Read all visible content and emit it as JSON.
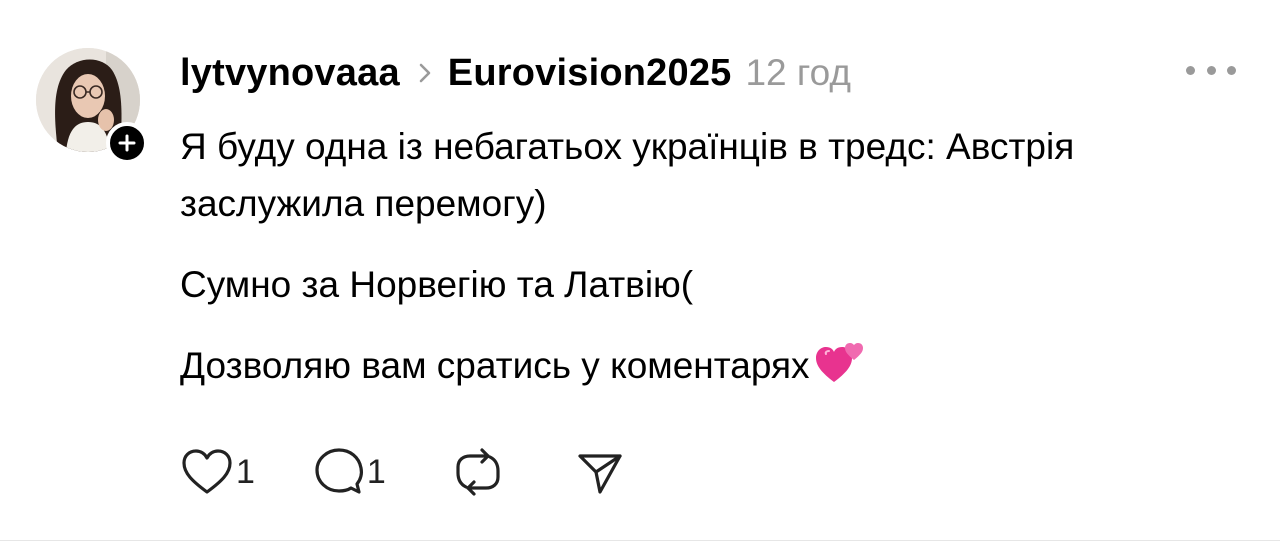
{
  "post": {
    "username": "lytvynovaaa",
    "community": "Eurovision2025",
    "timestamp": "12 год",
    "paragraphs": [
      "Я буду одна із небагатьох українців в тредс: Австрія заслужила перемогу)",
      "Сумно за Норвегію та Латвію(",
      "Дозволяю вам сратись у коментарях"
    ],
    "emoji": "two-hearts-emoji"
  },
  "actions": {
    "like_count": "1",
    "reply_count": "1"
  },
  "icons": {
    "more": "more-horizontal-icon",
    "chevron": "chevron-right-icon",
    "follow": "plus-icon",
    "like": "heart-icon",
    "reply": "comment-icon",
    "repost": "repost-icon",
    "share": "send-icon"
  },
  "colors": {
    "text": "#000000",
    "muted": "#9a9a9a",
    "emoji_pink": "#e8338f"
  }
}
